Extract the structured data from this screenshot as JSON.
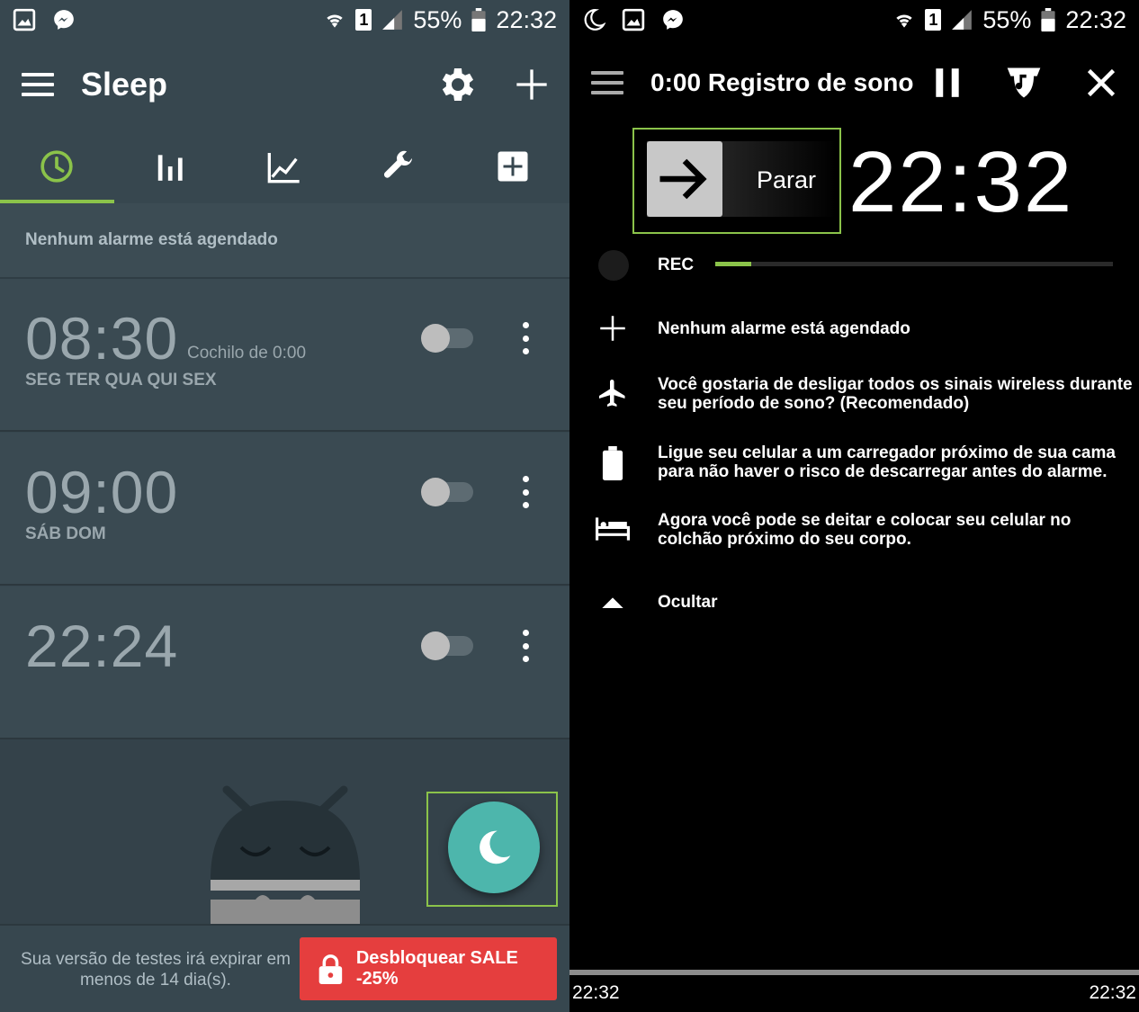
{
  "status_bar": {
    "battery_text": "55%",
    "time": "22:32",
    "sim_slot": "1"
  },
  "left": {
    "app_title": "Sleep",
    "tabs": [
      {
        "icon": "clock-icon",
        "active": true
      },
      {
        "icon": "bar-chart-icon",
        "active": false
      },
      {
        "icon": "line-chart-icon",
        "active": false
      },
      {
        "icon": "wrench-icon",
        "active": false
      },
      {
        "icon": "plus-box-icon",
        "active": false
      }
    ],
    "no_alarm_text": "Nenhum alarme está agendado",
    "alarms": [
      {
        "time": "08:30",
        "snooze": "Cochilo de 0:00",
        "days": "SEG TER QUA QUI SEX",
        "enabled": false
      },
      {
        "time": "09:00",
        "snooze": "",
        "days": "SÁB DOM",
        "enabled": false
      },
      {
        "time": "22:24",
        "snooze": "",
        "days": "",
        "enabled": false
      }
    ],
    "trial_text": "Sua versão de testes irá expirar em menos de 14 dia(s).",
    "unlock_label": "Desbloquear SALE -25%",
    "accent_color": "#8bc34a",
    "fab_color": "#4db6ac",
    "unlock_color": "#e53e3e"
  },
  "right": {
    "title": "0:00 Registro de sono",
    "stop_label": "Parar",
    "clock": "22:32",
    "rec_label": "REC",
    "rec_progress": 0.09,
    "info": [
      {
        "icon": "plus-icon",
        "text": "Nenhum alarme está agendado"
      },
      {
        "icon": "airplane-icon",
        "text": "Você gostaria de desligar todos os sinais wireless durante seu período de sono? (Recomendado)"
      },
      {
        "icon": "battery-icon",
        "text": "Ligue seu celular a um carregador próximo de sua cama para não haver o risco de descarregar antes do alarme."
      },
      {
        "icon": "bed-icon",
        "text": "Agora você pode se deitar e colocar seu celular no colchão próximo do seu corpo."
      },
      {
        "icon": "collapse-triangle-icon",
        "text": "Ocultar"
      }
    ],
    "timeline_start": "22:32",
    "timeline_end": "22:32"
  }
}
